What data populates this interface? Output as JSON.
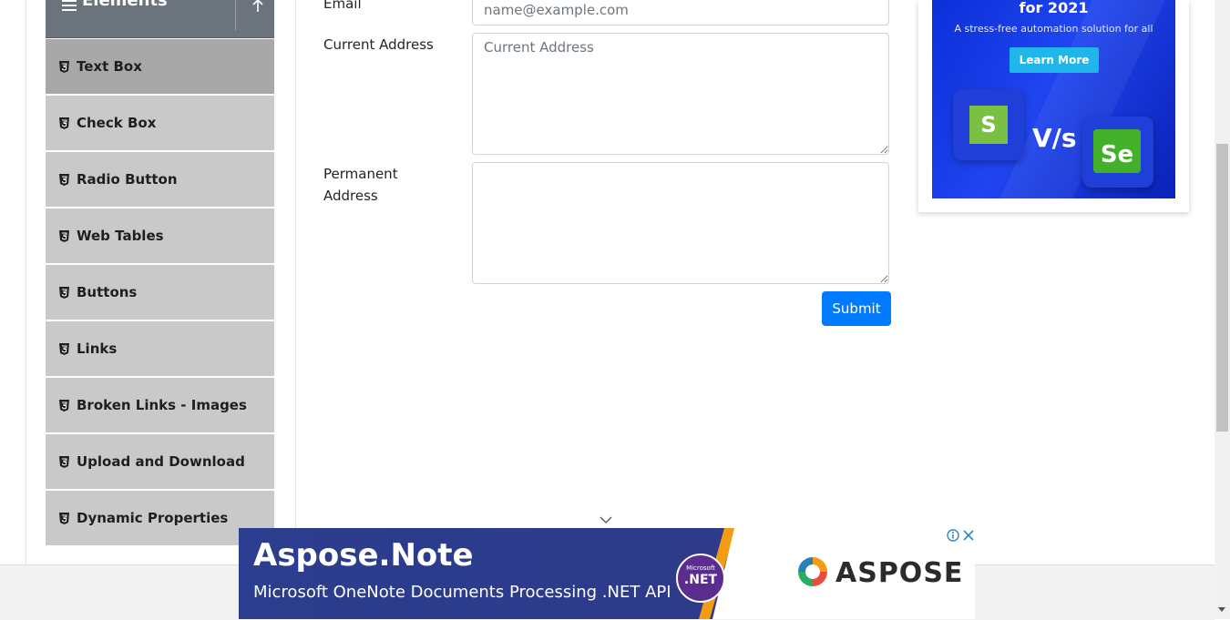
{
  "sidebar": {
    "group_title": "Elements",
    "items": [
      {
        "label": "Text Box",
        "active": true
      },
      {
        "label": "Check Box"
      },
      {
        "label": "Radio Button"
      },
      {
        "label": "Web Tables"
      },
      {
        "label": "Buttons"
      },
      {
        "label": "Links"
      },
      {
        "label": "Broken Links - Images"
      },
      {
        "label": "Upload and Download"
      },
      {
        "label": "Dynamic Properties"
      }
    ]
  },
  "form": {
    "email_label": "Email",
    "email_placeholder": "name@example.com",
    "current_address_label": "Current Address",
    "current_address_placeholder": "Current Address",
    "permanent_address_label_line1": "Permanent",
    "permanent_address_label_line2": "Address",
    "submit_label": "Submit"
  },
  "right_ad": {
    "headline": "for 2021",
    "subtext": "A stress-free automation solution for all",
    "button_label": "Learn More",
    "logo_left_letter": "S",
    "vs_text": "V/s",
    "logo_right_text": "Se"
  },
  "bottom_ad": {
    "title": "Aspose.Note",
    "subtitle": "Microsoft OneNote Documents Processing .NET API",
    "badge_small": "Microsoft",
    "badge_big": ".NET",
    "brand": "ASPOSE"
  },
  "colors": {
    "primary": "#007bff",
    "sidebar_header": "#6b737c",
    "sidebar_item": "#c9c9c9",
    "sidebar_item_active": "#a8a8a8"
  }
}
